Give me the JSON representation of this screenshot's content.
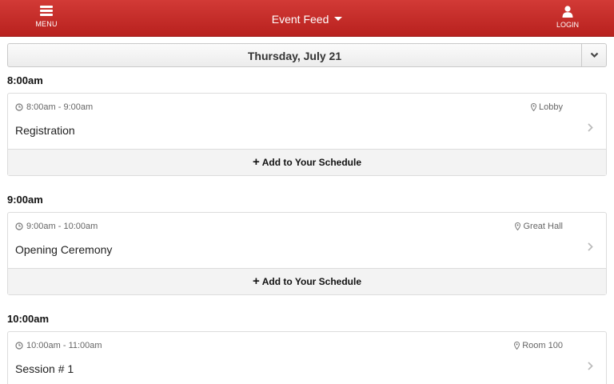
{
  "header": {
    "menu_label": "MENU",
    "title": "Event Feed",
    "login_label": "LOGIN",
    "accent_color": "#c52b27"
  },
  "date_selector": {
    "value": "Thursday, July 21"
  },
  "groups": [
    {
      "heading": "8:00am",
      "event": {
        "time": "8:00am - 9:00am",
        "location": "Lobby",
        "title": "Registration",
        "add_label": "Add to Your Schedule",
        "add_icon": "plus-icon"
      }
    },
    {
      "heading": "9:00am",
      "event": {
        "time": "9:00am - 10:00am",
        "location": "Great Hall",
        "title": "Opening Ceremony",
        "add_label": "Add to Your Schedule",
        "add_icon": "plus-icon"
      }
    },
    {
      "heading": "10:00am",
      "event": {
        "time": "10:00am - 11:00am",
        "location": "Room 100",
        "title": "Session # 1"
      }
    }
  ]
}
